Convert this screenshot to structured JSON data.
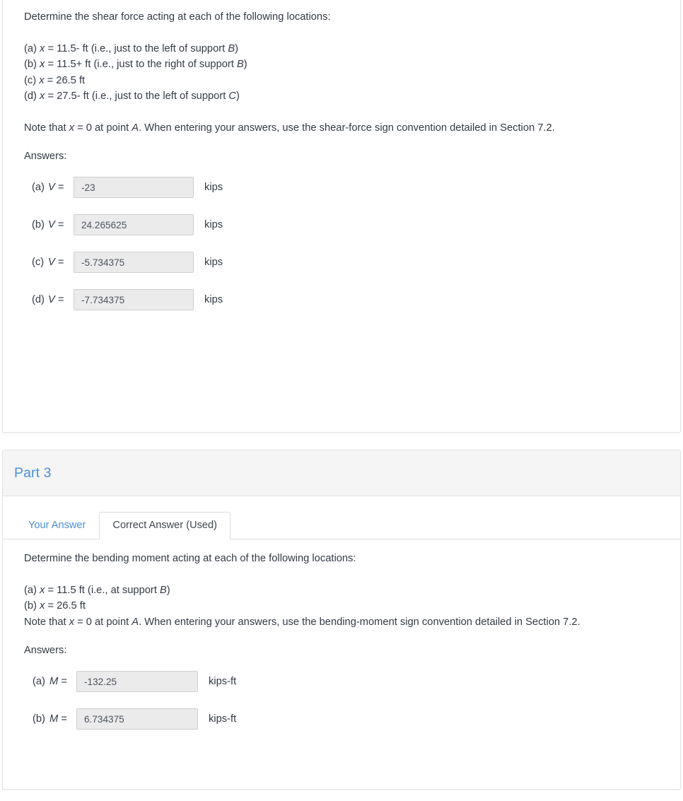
{
  "panel_one": {
    "prompt": "Determine the shear force acting at each of the following locations:",
    "locations": [
      {
        "tag": "(a) ",
        "var": "x",
        "mid": " = 11.5- ft (i.e., just to the left of support ",
        "sub": "B",
        "end": ")"
      },
      {
        "tag": "(b) ",
        "var": "x",
        "mid": " = 11.5+ ft (i.e., just to the right of support ",
        "sub": "B",
        "end": ")"
      },
      {
        "tag": "(c) ",
        "var": "x",
        "mid": " = 26.5 ft",
        "sub": "",
        "end": ""
      },
      {
        "tag": "(d) ",
        "var": "x",
        "mid": " = 27.5- ft (i.e., just to the left of support ",
        "sub": "C",
        "end": ")"
      }
    ],
    "note_pre": "Note that ",
    "note_var": "x",
    "note_mid": " = 0 at point ",
    "note_point": "A",
    "note_end": ". When entering your answers, use the shear-force sign convention detailed in Section 7.2.",
    "answers_label": "Answers:",
    "answers": [
      {
        "label": "(a)",
        "var": "V",
        "eq": " =",
        "value": "-23",
        "unit": "kips"
      },
      {
        "label": "(b)",
        "var": "V",
        "eq": " =",
        "value": "24.265625",
        "unit": "kips"
      },
      {
        "label": "(c)",
        "var": "V",
        "eq": " =",
        "value": "-5.734375",
        "unit": "kips"
      },
      {
        "label": "(d)",
        "var": "V",
        "eq": " =",
        "value": "-7.734375",
        "unit": "kips"
      }
    ]
  },
  "panel_two": {
    "title": "Part 3",
    "tabs": [
      {
        "label": "Your Answer",
        "active": false
      },
      {
        "label": "Correct Answer (Used)",
        "active": true
      }
    ],
    "prompt": "Determine the bending moment acting at each of the following locations:",
    "locations": [
      {
        "tag": "(a) ",
        "var": "x",
        "mid": " = 11.5 ft (i.e., at support ",
        "sub": "B",
        "end": ")"
      },
      {
        "tag": "(b) ",
        "var": "x",
        "mid": " = 26.5 ft",
        "sub": "",
        "end": ""
      }
    ],
    "note_pre": "Note that ",
    "note_var": "x",
    "note_mid": " = 0 at point ",
    "note_point": "A",
    "note_end": ".  When entering your answers, use the bending-moment sign convention detailed in Section 7.2.",
    "answers_label": "Answers:",
    "answers": [
      {
        "label": "(a)",
        "var": "M",
        "eq": " =",
        "value": "-132.25",
        "unit": "kips-ft"
      },
      {
        "label": "(b)",
        "var": "M",
        "eq": " =",
        "value": "6.734375",
        "unit": "kips-ft"
      }
    ]
  },
  "colors": {
    "link_blue": "#4a90d9",
    "text": "#333a45",
    "panel_border": "#e3e3e3",
    "input_bg": "#ebebeb",
    "input_border": "#cfcfcf",
    "heading_bg": "#f5f5f5"
  }
}
